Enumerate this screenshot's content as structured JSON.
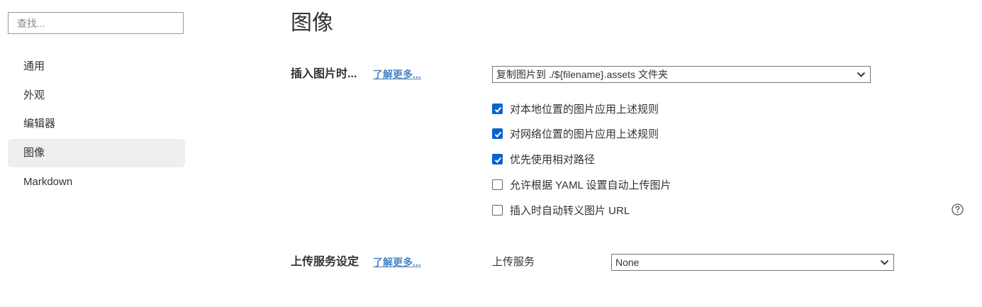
{
  "sidebar": {
    "search_placeholder": "查找...",
    "items": [
      {
        "label": "通用"
      },
      {
        "label": "外观"
      },
      {
        "label": "编辑器"
      },
      {
        "label": "图像"
      },
      {
        "label": "Markdown"
      }
    ],
    "active_item": "图像"
  },
  "main": {
    "title": "图像",
    "insert_section": {
      "label": "插入图片时...",
      "learn_more": "了解更多...",
      "select_value": "复制图片到 ./${filename}.assets 文件夹",
      "options": [
        {
          "label": "对本地位置的图片应用上述规则",
          "checked": true
        },
        {
          "label": "对网络位置的图片应用上述规则",
          "checked": true
        },
        {
          "label": "优先使用相对路径",
          "checked": true
        },
        {
          "label": "允许根据 YAML 设置自动上传图片",
          "checked": false
        },
        {
          "label": "插入时自动转义图片 URL",
          "checked": false
        }
      ]
    },
    "upload_section": {
      "label": "上传服务设定",
      "learn_more": "了解更多...",
      "service_label": "上传服务",
      "service_value": "None"
    }
  },
  "colors": {
    "accent": "#0a63d1",
    "link": "#4a86c5",
    "active_bg": "#eeeeee"
  },
  "icons": {
    "select_arrow": "chevron-down-icon",
    "help": "question-circle-icon",
    "checkbox": "checkmark-icon"
  }
}
